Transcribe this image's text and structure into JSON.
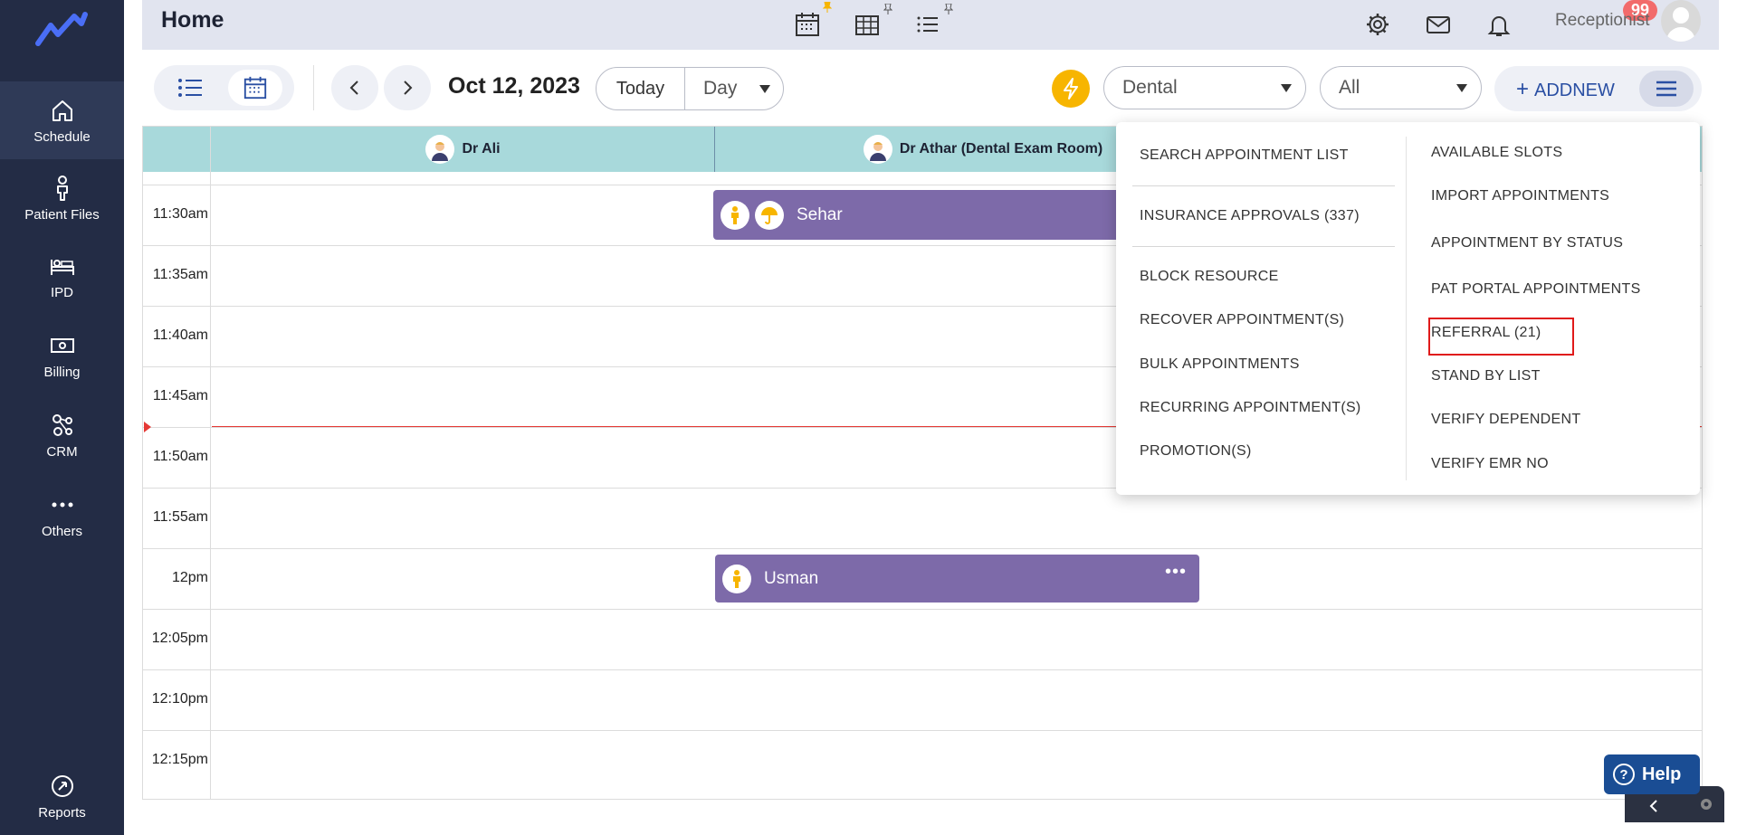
{
  "sidebar": {
    "items": [
      {
        "label": "Schedule",
        "icon": "home-icon"
      },
      {
        "label": "Patient Files",
        "icon": "person-icon"
      },
      {
        "label": "IPD",
        "icon": "bed-icon"
      },
      {
        "label": "Billing",
        "icon": "money-icon"
      },
      {
        "label": "CRM",
        "icon": "crm-icon"
      },
      {
        "label": "Others",
        "icon": "more-icon"
      }
    ],
    "reports_label": "Reports"
  },
  "header": {
    "title": "Home",
    "notification_count": "99",
    "user_role": "Receptionist"
  },
  "toolbar": {
    "date": "Oct 12, 2023",
    "today_label": "Today",
    "view_select": "Day",
    "department_select": "Dental",
    "filter_select": "All",
    "addnew_label": "ADDNEW"
  },
  "calendar": {
    "columns": [
      {
        "name": "Dr Ali"
      },
      {
        "name": "Dr Athar (Dental Exam Room)"
      }
    ],
    "time_slots": [
      "11:30am",
      "11:35am",
      "11:40am",
      "11:45am",
      "11:50am",
      "11:55am",
      "12pm",
      "12:05pm",
      "12:10pm",
      "12:15pm"
    ],
    "appointments": [
      {
        "patient": "Sehar"
      },
      {
        "patient": "Usman"
      }
    ]
  },
  "menu": {
    "left": [
      "SEARCH APPOINTMENT LIST",
      "INSURANCE APPROVALS (337)",
      "BLOCK RESOURCE",
      "RECOVER APPOINTMENT(S)",
      "BULK APPOINTMENTS",
      "RECURRING APPOINTMENT(S)",
      "PROMOTION(S)"
    ],
    "right": [
      "AVAILABLE SLOTS",
      "IMPORT APPOINTMENTS",
      "APPOINTMENT BY STATUS",
      "PAT PORTAL APPOINTMENTS",
      "REFERRAL (21)",
      "STAND BY LIST",
      "VERIFY DEPENDENT",
      "VERIFY EMR NO"
    ]
  },
  "help": {
    "label": "Help"
  },
  "colors": {
    "sidebar": "#232c45",
    "calendar_header": "#a8d9db",
    "appointment": "#7d6aa9",
    "accent": "#f7b500",
    "brand_blue": "#2a4fa3",
    "now_line": "#e53935"
  }
}
